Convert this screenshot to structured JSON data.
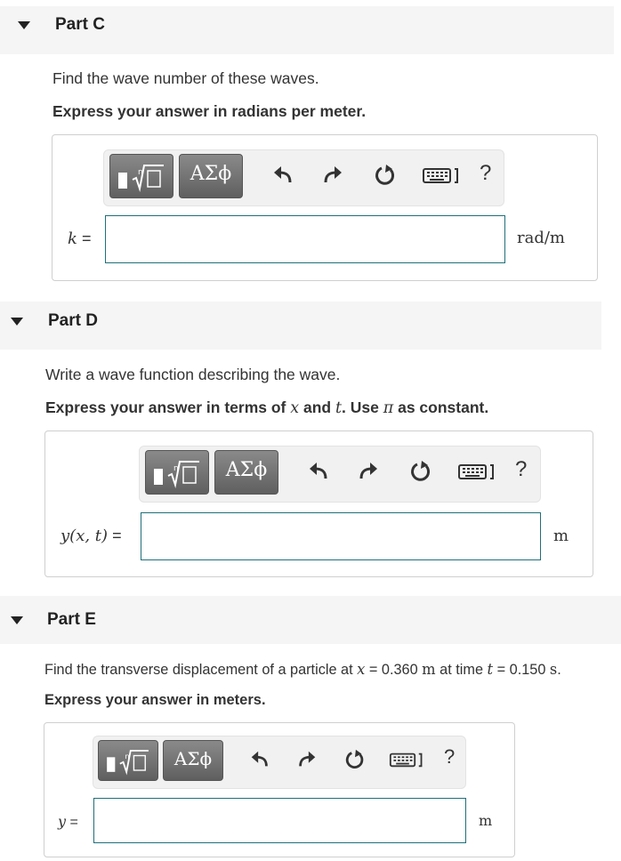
{
  "parts": [
    {
      "title": "Part C",
      "question": "Find the wave number of these waves.",
      "instruction": "Express your answer in radians per meter.",
      "variable": "k",
      "equals": "=",
      "unit": "rad/m",
      "input_value": ""
    },
    {
      "title": "Part D",
      "question": "Write a wave function describing the wave.",
      "instruction_pre": "Express your answer in terms of ",
      "instruction_x": "x",
      "instruction_and": " and ",
      "instruction_t": "t",
      "instruction_mid": ". Use ",
      "instruction_pi": "π",
      "instruction_post": " as constant.",
      "variable": "y(x, t)",
      "equals": "=",
      "unit": "m",
      "input_value": ""
    },
    {
      "title": "Part E",
      "question_pre": "Find the transverse displacement of a particle at ",
      "question_x": "x",
      "question_eq1": " = 0.360 ",
      "question_m": "m",
      "question_mid": " at time ",
      "question_t": "t",
      "question_eq2": " = 0.150 ",
      "question_s": "s",
      "question_end": ".",
      "instruction": "Express your answer in meters.",
      "variable": "y",
      "equals": "=",
      "unit": "m",
      "input_value": ""
    }
  ],
  "toolbar": {
    "templates_icon": "fraction-root-template-icon",
    "greek_label": "ΑΣϕ",
    "undo_icon": "undo-icon",
    "redo_icon": "redo-icon",
    "reset_icon": "reset-icon",
    "keyboard_icon": "keyboard-icon",
    "help_label": "?"
  },
  "colors": {
    "header_bg": "#f5f5f5",
    "input_border": "#1f6f7a",
    "toolbar_button": "#6e6e6e"
  }
}
